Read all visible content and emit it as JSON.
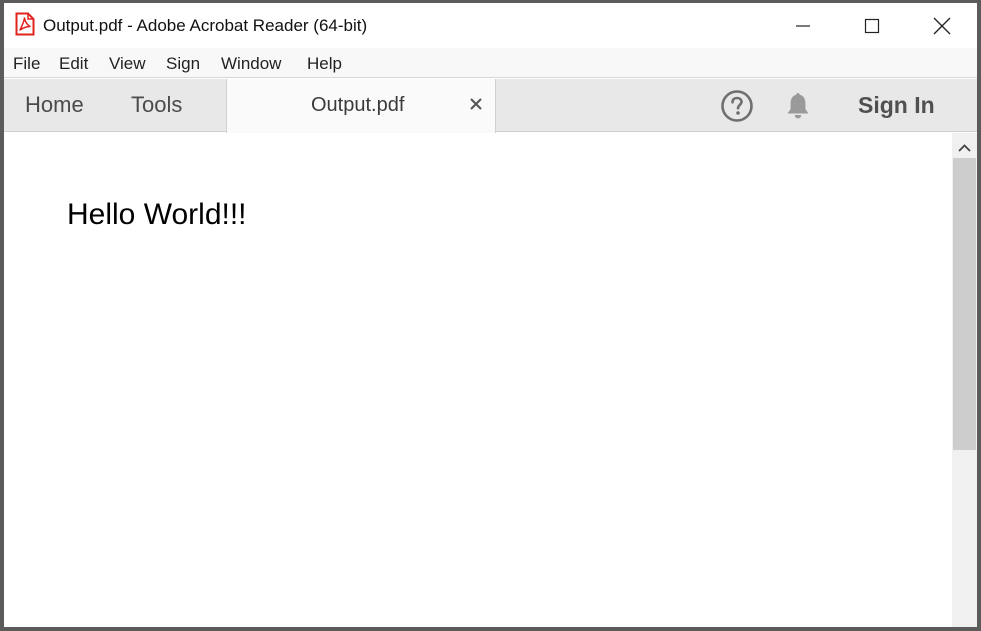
{
  "window": {
    "title": "Output.pdf - Adobe Acrobat Reader (64-bit)",
    "icon": "acrobat-pdf-icon",
    "controls": [
      "minimize-icon",
      "maximize-icon",
      "close-icon"
    ]
  },
  "menu": {
    "items": [
      "File",
      "Edit",
      "View",
      "Sign",
      "Window",
      "Help"
    ]
  },
  "toolbar": {
    "home_label": "Home",
    "tools_label": "Tools",
    "document_tab": {
      "label": "Output.pdf",
      "close_glyph": "×"
    },
    "help_icon": "question-circle-icon",
    "notifications_icon": "bell-icon",
    "sign_in_label": "Sign In"
  },
  "document": {
    "text": "Hello World!!!"
  },
  "colors": {
    "acrobat_red": "#e0231d",
    "tabbar_bg": "#e8e8e8",
    "icon_gray": "#6f6f6f"
  }
}
